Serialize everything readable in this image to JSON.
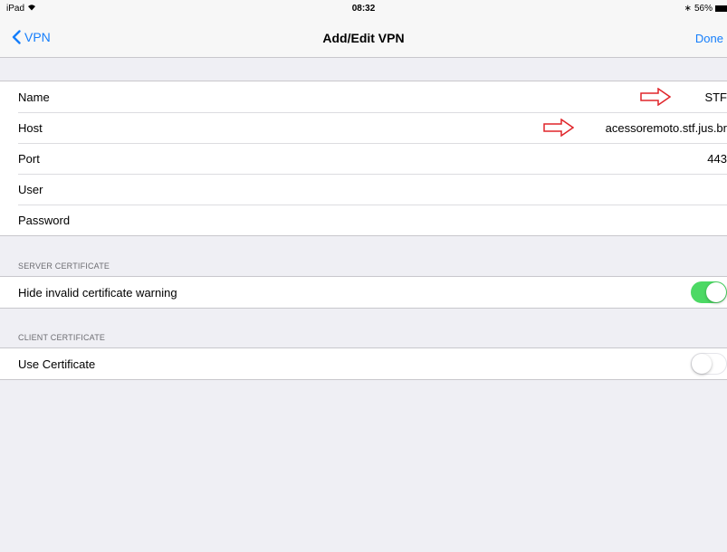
{
  "status_bar": {
    "device": "iPad",
    "time": "08:32",
    "battery": "56%"
  },
  "nav": {
    "back_label": "VPN",
    "title": "Add/Edit VPN",
    "done_label": "Done"
  },
  "fields": {
    "name_label": "Name",
    "name_value": "STF",
    "host_label": "Host",
    "host_value": "acessoremoto.stf.jus.br",
    "port_label": "Port",
    "port_value": "443",
    "user_label": "User",
    "user_value": "",
    "password_label": "Password",
    "password_value": ""
  },
  "server_certificate": {
    "header": "SERVER CERTIFICATE",
    "hide_warning_label": "Hide invalid certificate warning",
    "hide_warning_on": true
  },
  "client_certificate": {
    "header": "CLIENT CERTIFICATE",
    "use_certificate_label": "Use Certificate",
    "use_certificate_on": false
  },
  "colors": {
    "accent": "#157efb",
    "toggle_on": "#4cd964",
    "annotation_arrow": "#e0252a"
  }
}
